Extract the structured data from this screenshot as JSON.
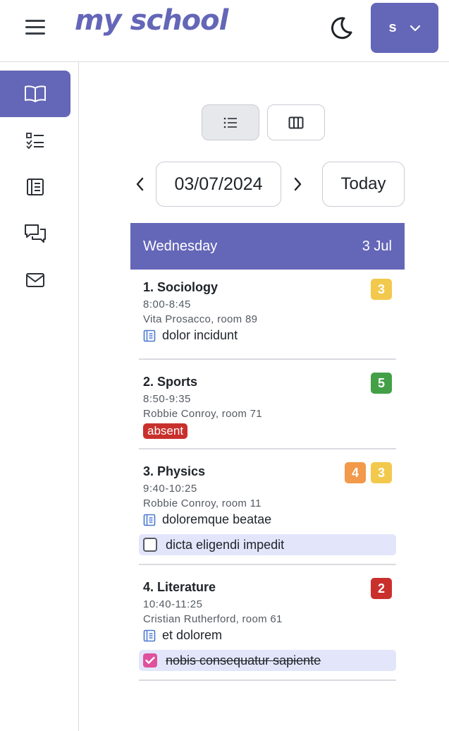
{
  "header": {
    "logo": "my school",
    "user_initial": "s"
  },
  "sidebar": {
    "items": [
      {
        "name": "sidebar-item-timetable",
        "icon": "book-icon",
        "active": true
      },
      {
        "name": "sidebar-item-tasks",
        "icon": "checklist-icon",
        "active": false
      },
      {
        "name": "sidebar-item-grades",
        "icon": "journal-icon",
        "active": false
      },
      {
        "name": "sidebar-item-messages",
        "icon": "chat-icon",
        "active": false
      },
      {
        "name": "sidebar-item-mail",
        "icon": "mail-icon",
        "active": false
      }
    ]
  },
  "toolbar": {
    "date": "03/07/2024",
    "today_label": "Today"
  },
  "day": {
    "weekday": "Wednesday",
    "date": "3 Jul"
  },
  "lessons": [
    {
      "title": "1. Sociology",
      "time": "8:00-8:45",
      "teacher": "Vita Prosacco, room 89",
      "grades": [
        "3"
      ],
      "homework": "dolor incidunt"
    },
    {
      "title": "2. Sports",
      "time": "8:50-9:35",
      "teacher": "Robbie Conroy, room 71",
      "grades": [
        "5"
      ],
      "status": "absent"
    },
    {
      "title": "3. Physics",
      "time": "9:40-10:25",
      "teacher": "Robbie Conroy, room 11",
      "grades": [
        "4",
        "3"
      ],
      "homework": "doloremque beatae",
      "task": "dicta eligendi impedit",
      "task_done": false
    },
    {
      "title": "4. Literature",
      "time": "10:40-11:25",
      "teacher": "Cristian Rutherford, room 61",
      "grades": [
        "2"
      ],
      "homework": "et dolorem",
      "task": "nobis consequatur sapiente",
      "task_done": true
    }
  ],
  "colors": {
    "accent": "#6466b8",
    "grade_3": "#f2c94c",
    "grade_4": "#f2994a",
    "grade_5": "#43a047",
    "grade_2": "#c9302c",
    "absent": "#c9302c",
    "task_bg": "#e3e6fb",
    "checked": "#e0509c"
  }
}
